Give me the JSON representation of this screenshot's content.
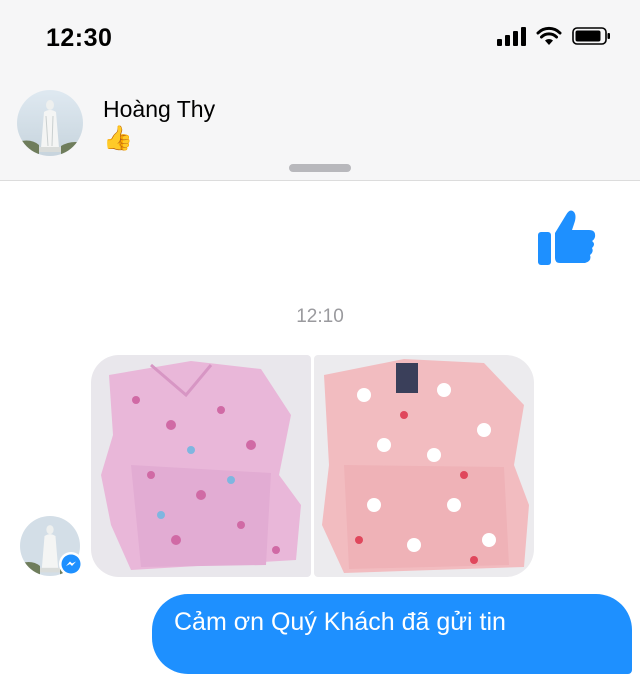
{
  "status_bar": {
    "time": "12:30",
    "icons": [
      "cellular-signal-icon",
      "wifi-icon",
      "battery-icon"
    ]
  },
  "header": {
    "contact_name": "Hoàng Thy",
    "contact_emoji": "👍",
    "avatar": "statue-avatar"
  },
  "conversation": {
    "sent_reaction": "thumbs-up-icon",
    "timestamp": "12:10",
    "photos": [
      "pink-pajama-set-photo",
      "peach-pajama-set-photo"
    ],
    "outgoing_message": "Cảm ơn Quý Khách đã gửi tin"
  },
  "colors": {
    "accent": "#1e90ff",
    "header_bg": "#f6f6f7",
    "timestamp": "#9a9a9e"
  }
}
